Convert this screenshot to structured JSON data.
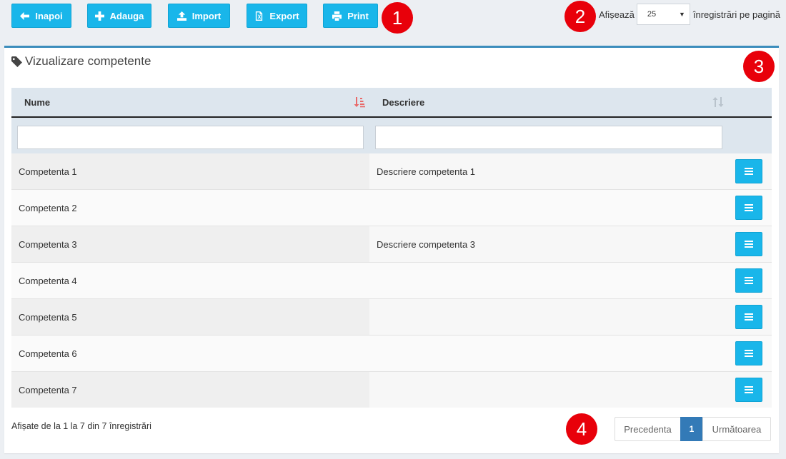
{
  "toolbar": {
    "back_label": "Inapoi",
    "add_label": "Adauga",
    "import_label": "Import",
    "export_label": "Export",
    "print_label": "Print"
  },
  "page_size": {
    "prefix": "Afișează",
    "value": "25",
    "suffix": "înregistrări pe pagină"
  },
  "panel": {
    "title": "Vizualizare competente"
  },
  "table": {
    "columns": [
      "Nume",
      "Descriere"
    ],
    "filters": {
      "nume_value": "",
      "descriere_value": ""
    },
    "rows": [
      {
        "nume": "Competenta 1",
        "descriere": "Descriere competenta 1"
      },
      {
        "nume": "Competenta 2",
        "descriere": ""
      },
      {
        "nume": "Competenta 3",
        "descriere": "Descriere competenta 3"
      },
      {
        "nume": "Competenta 4",
        "descriere": ""
      },
      {
        "nume": "Competenta 5",
        "descriere": ""
      },
      {
        "nume": "Competenta 6",
        "descriere": ""
      },
      {
        "nume": "Competenta 7",
        "descriere": ""
      }
    ]
  },
  "footer": {
    "info": "Afișate de la 1 la 7 din 7 înregistrări",
    "prev_label": "Precedenta",
    "current_page": "1",
    "next_label": "Următoarea"
  },
  "markers": [
    "1",
    "2",
    "3",
    "4"
  ],
  "colors": {
    "button": "#19b6ea",
    "panel_accent": "#3c8dbc",
    "header_bg": "#dde6ee",
    "marker": "#e8000a",
    "pager_active": "#337ab7",
    "sort_active": "#e86a6a"
  },
  "icons": {
    "back": "arrow-left-icon",
    "add": "plus-icon",
    "import": "upload-icon",
    "export": "file-excel-icon",
    "print": "print-icon",
    "title": "tag-icon",
    "sort_active": "sort-amount-down-icon",
    "sort": "sort-icon",
    "row_action": "bars-icon"
  }
}
